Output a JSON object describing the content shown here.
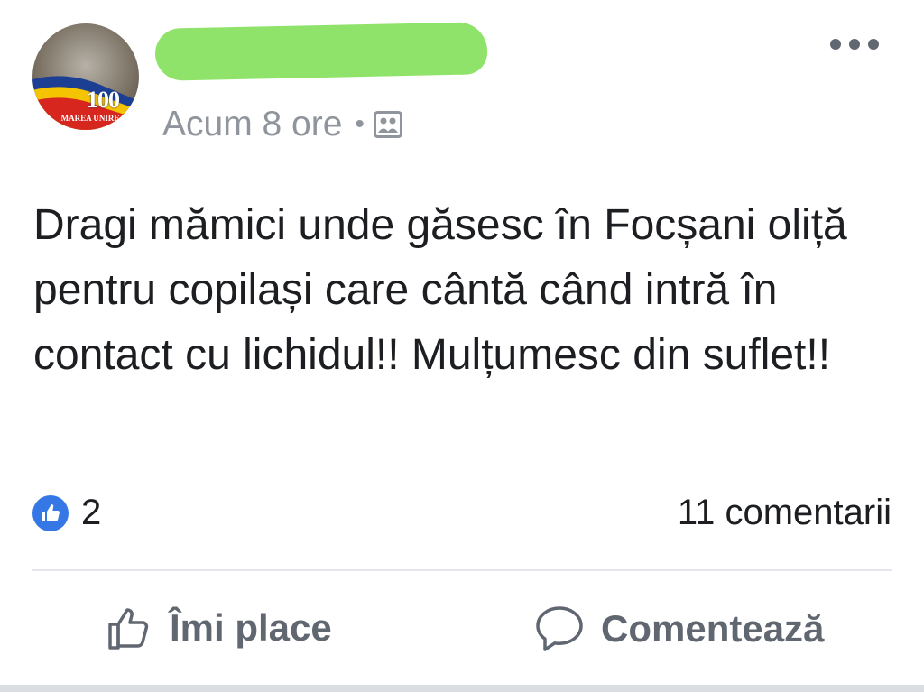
{
  "post": {
    "author_avatar_caption": "100",
    "author_avatar_subcaption": "MAREA UNIRE",
    "timestamp": "Acum 8 ore",
    "separator": "•",
    "audience_icon": "public-group-icon",
    "text": "Dragi mămici unde găsesc în Focșani oliță pentru copilași care cântă când intră în contact cu lichidul!! Mulțumesc din suflet!!",
    "likes_count": "2",
    "comments_count": "11 comentarii"
  },
  "actions": {
    "like_label": "Îmi place",
    "comment_label": "Comentează"
  },
  "colors": {
    "like_blue": "#3578e5",
    "meta_gray": "#90949c",
    "action_gray": "#606770",
    "redaction_green": "#8fe36a"
  }
}
